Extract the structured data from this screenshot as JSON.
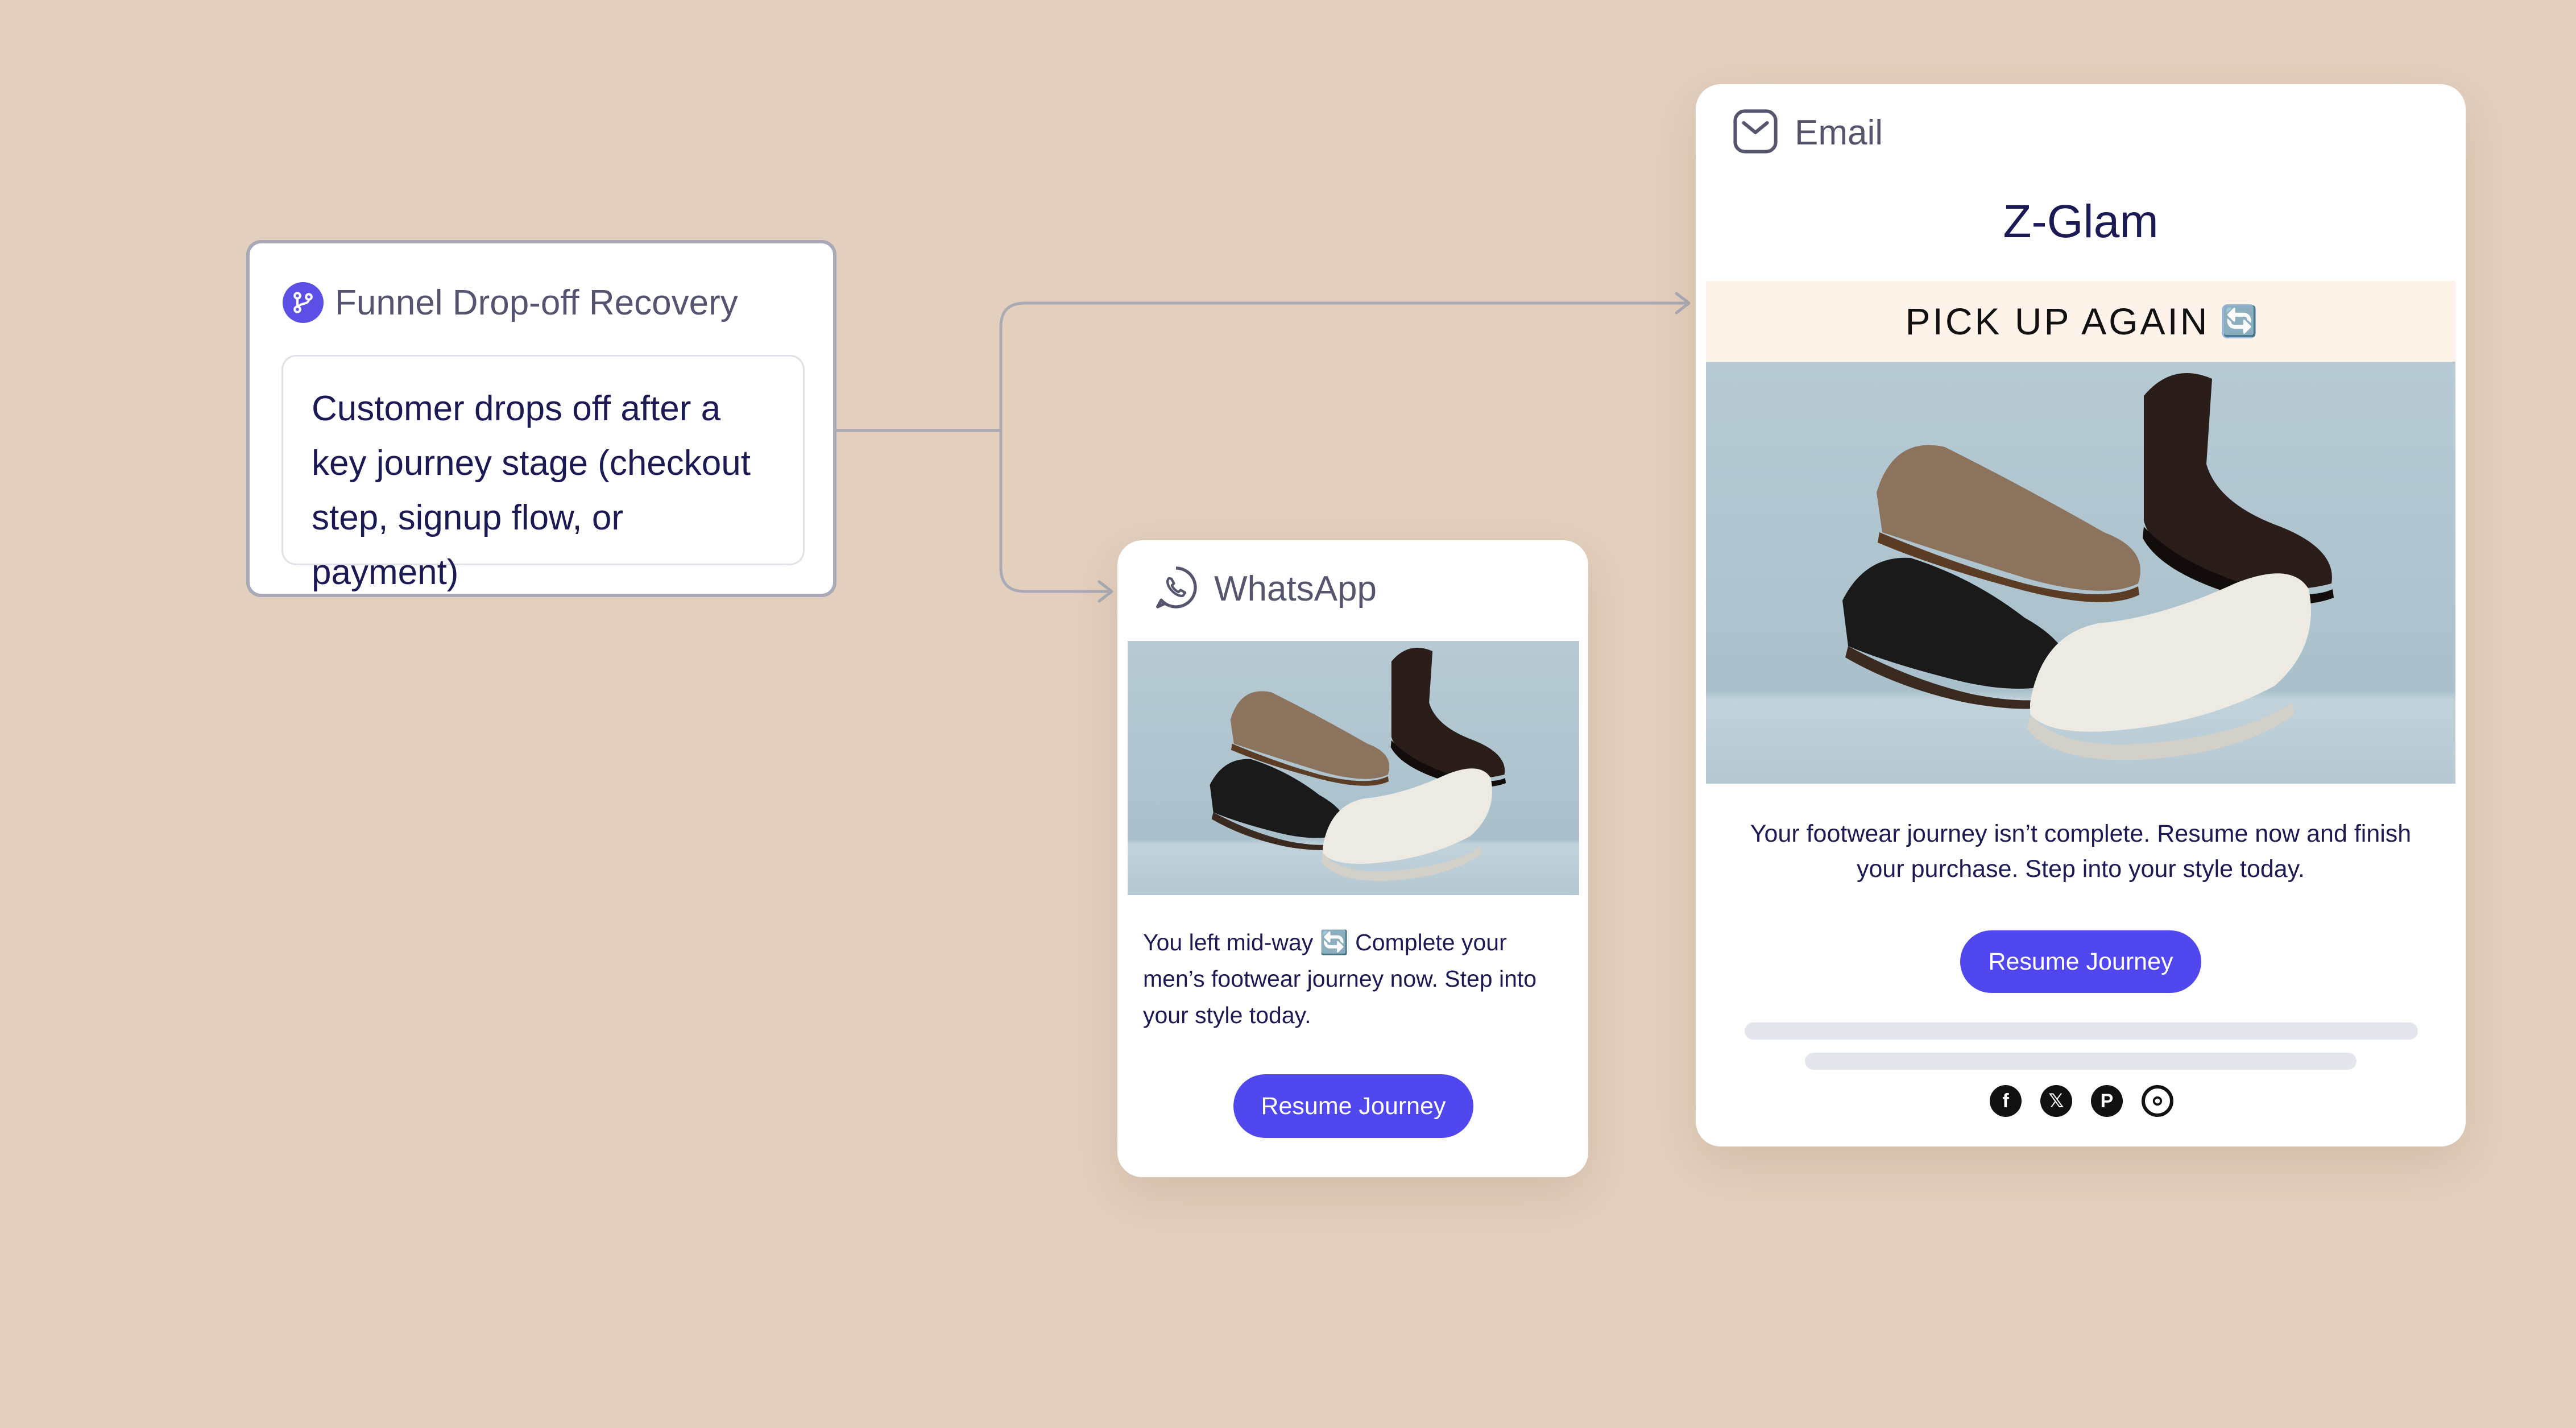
{
  "trigger": {
    "title": "Funnel Drop-off Recovery",
    "icon": "flow-branch-icon",
    "description": "Customer drops off after a key journey stage (checkout step, signup flow, or payment)"
  },
  "whatsapp": {
    "channel_label": "WhatsApp",
    "icon": "whatsapp-icon",
    "image_alt": "Men's shoes: loafer, chelsea boot, derby, white sneaker",
    "message": "You left mid-way 🔄 Complete your men’s footwear journey now. Step into your style today.",
    "button_label": "Resume Journey"
  },
  "email": {
    "channel_label": "Email",
    "icon": "mail-icon",
    "brand": "Z-Glam",
    "banner": "PICK UP AGAIN",
    "banner_emoji": "🔄",
    "image_alt": "Men's shoes: loafer, chelsea boot, derby, white sneaker",
    "body": "Your footwear journey isn’t complete. Resume now and finish your purchase. Step into your style today.",
    "button_label": "Resume Journey",
    "social_icons": [
      "facebook-icon",
      "x-icon",
      "pinterest-icon",
      "instagram-icon"
    ]
  },
  "colors": {
    "background": "#e3cfbd",
    "accent": "#5147ef",
    "text_dark": "#1c1a55",
    "connector": "#a9aab5"
  }
}
